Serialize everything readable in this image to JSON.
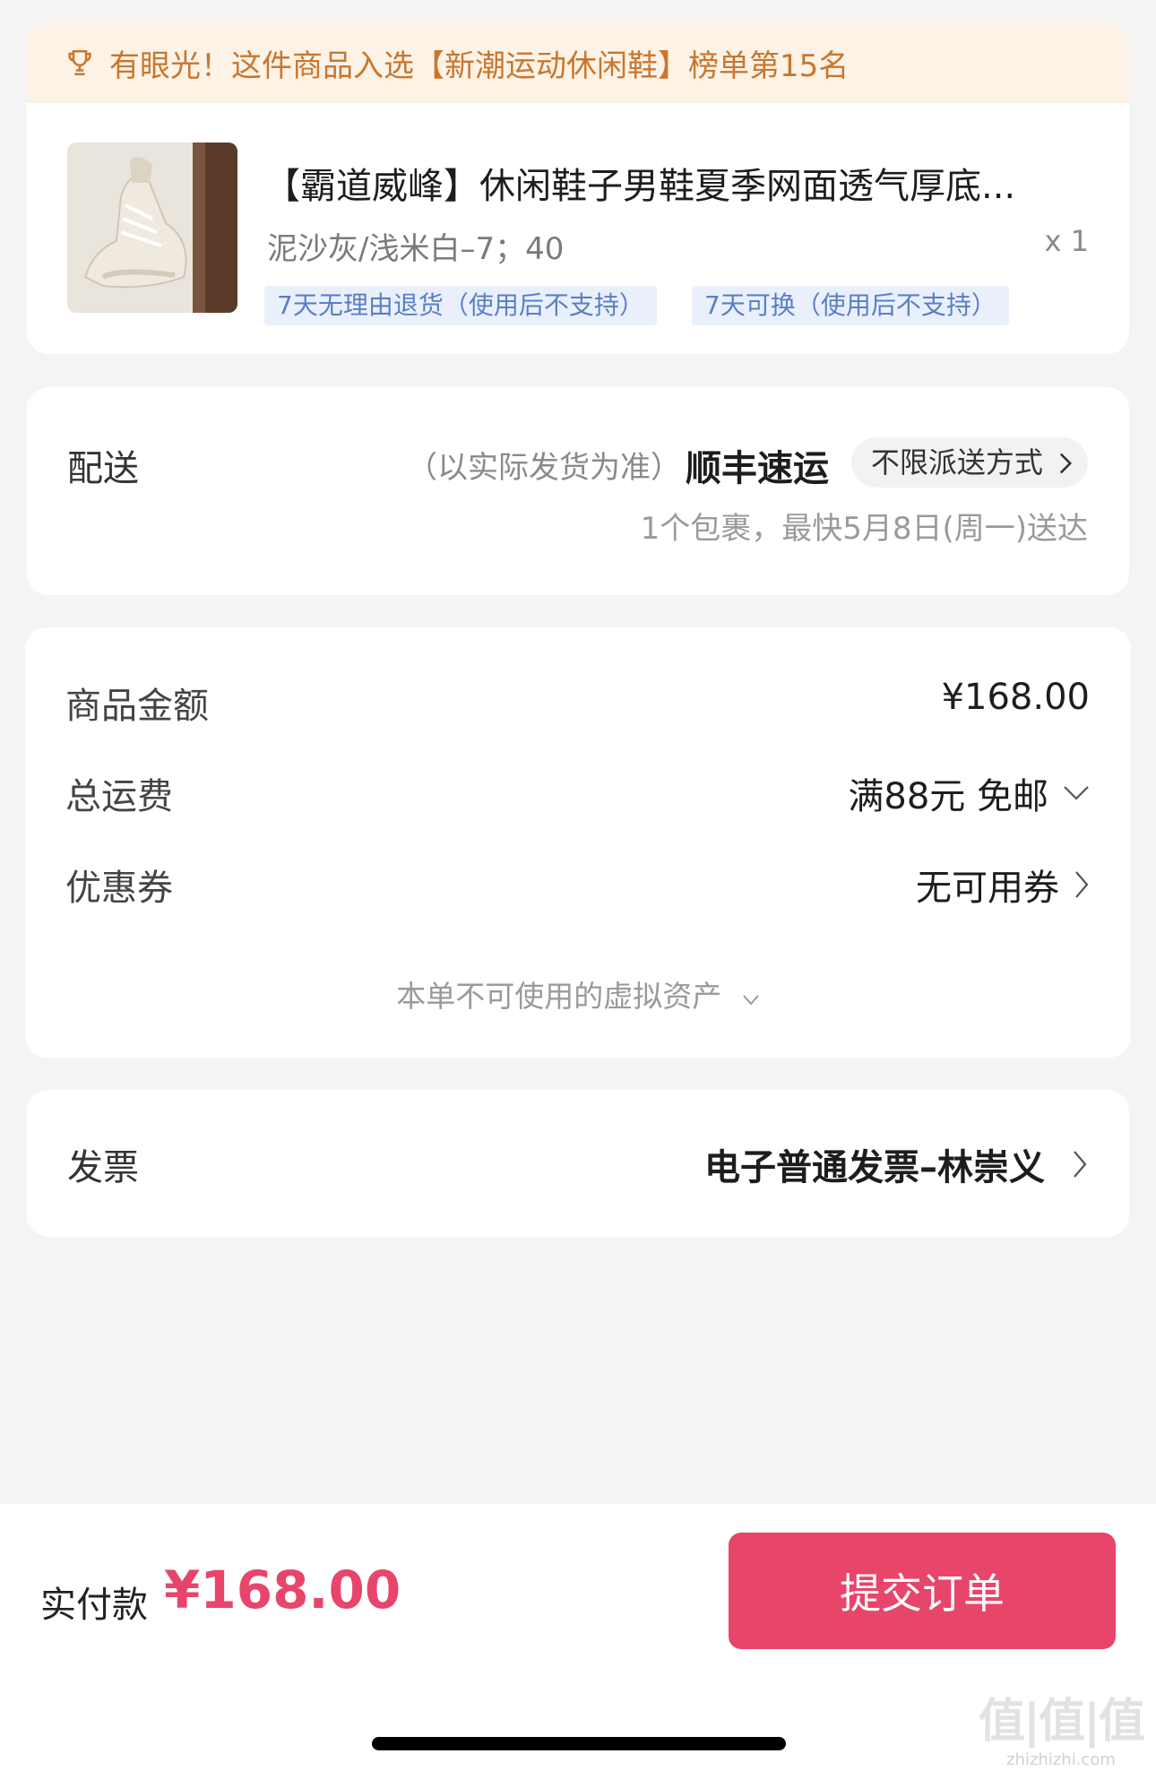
{
  "product": {
    "rank_banner": "有眼光！这件商品入选【新潮运动休闲鞋】榜单第15名",
    "title": "【霸道威峰】休闲鞋子男鞋夏季网面透气厚底...",
    "spec": "泥沙灰/浅米白–7；40",
    "quantity": "x 1",
    "tags": [
      "7天无理由退货（使用后不支持）",
      "7天可换（使用后不支持）"
    ]
  },
  "delivery": {
    "label": "配送",
    "note": "（以实际发货为准）",
    "carrier": "顺丰速运",
    "method": "不限派送方式",
    "eta": "1个包裹，最快5月8日(周一)送达"
  },
  "pricing": {
    "goods_label": "商品金额",
    "goods_value": "¥168.00",
    "shipping_label": "总运费",
    "shipping_value": "满88元 免邮",
    "coupon_label": "优惠券",
    "coupon_value": "无可用券",
    "virtual_assets_note": "本单不可使用的虚拟资产"
  },
  "invoice": {
    "label": "发票",
    "value": "电子普通发票–林崇义"
  },
  "footer": {
    "pay_label": "实付款",
    "pay_amount": "¥168.00",
    "submit_label": "提交订单"
  },
  "watermark": {
    "big": "值|值|值",
    "small": "zhizhizhi.com"
  },
  "colors": {
    "accent": "#e8456b",
    "banner_bg": "#fdf2e6",
    "banner_text": "#c8772f",
    "tag_bg": "#eaf0fb",
    "tag_text": "#5a7fc4"
  }
}
